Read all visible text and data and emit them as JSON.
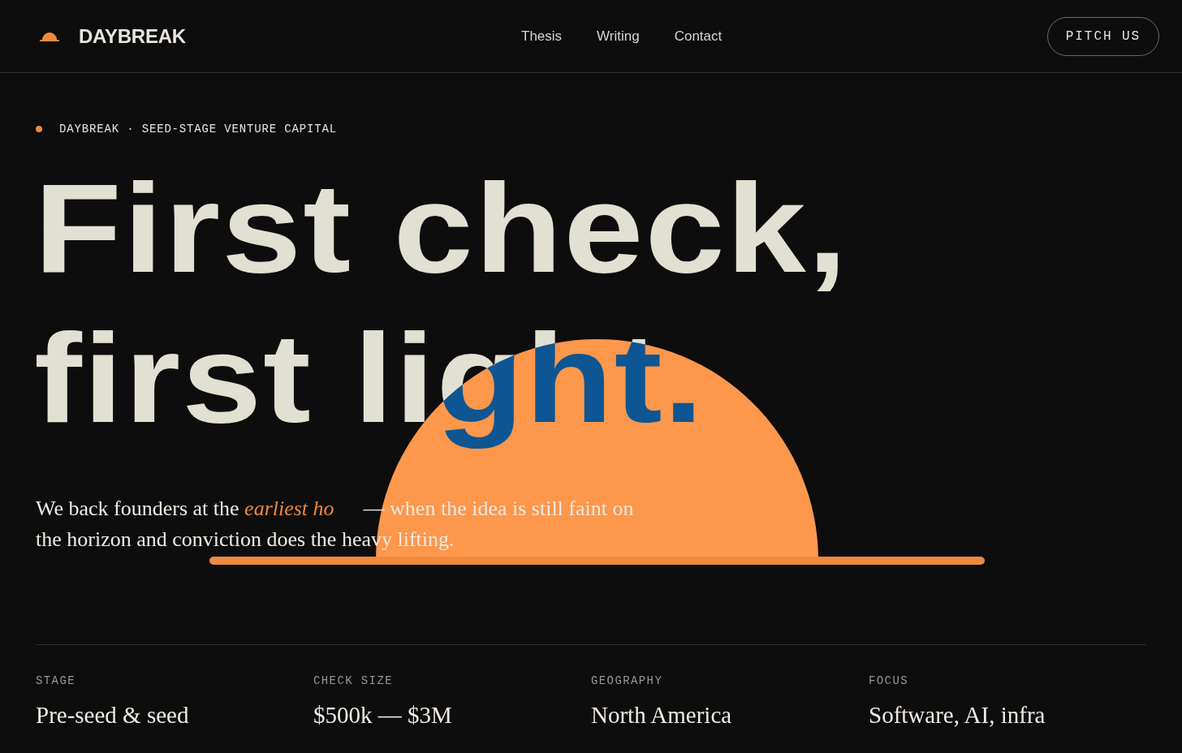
{
  "nav": {
    "brand": "DAYBREAK",
    "links": [
      "Thesis",
      "Writing",
      "Contact"
    ],
    "cta": "PITCH US"
  },
  "eyebrow": "DAYBREAK · SEED-STAGE VENTURE CAPITAL",
  "headline": [
    "First check,",
    "first light."
  ],
  "intro": {
    "before": "We back founders at the *earliest ho*",
    "after": "— when the idea is still faint on the horizon and conviction does the heavy lifting."
  },
  "stats": [
    {
      "label": "STAGE",
      "value": "Pre-seed & seed"
    },
    {
      "label": "CHECK SIZE",
      "value": "$500k — $3M"
    },
    {
      "label": "GEOGRAPHY",
      "value": "North America"
    },
    {
      "label": "FOCUS",
      "value": "Software, AI, infra"
    }
  ]
}
